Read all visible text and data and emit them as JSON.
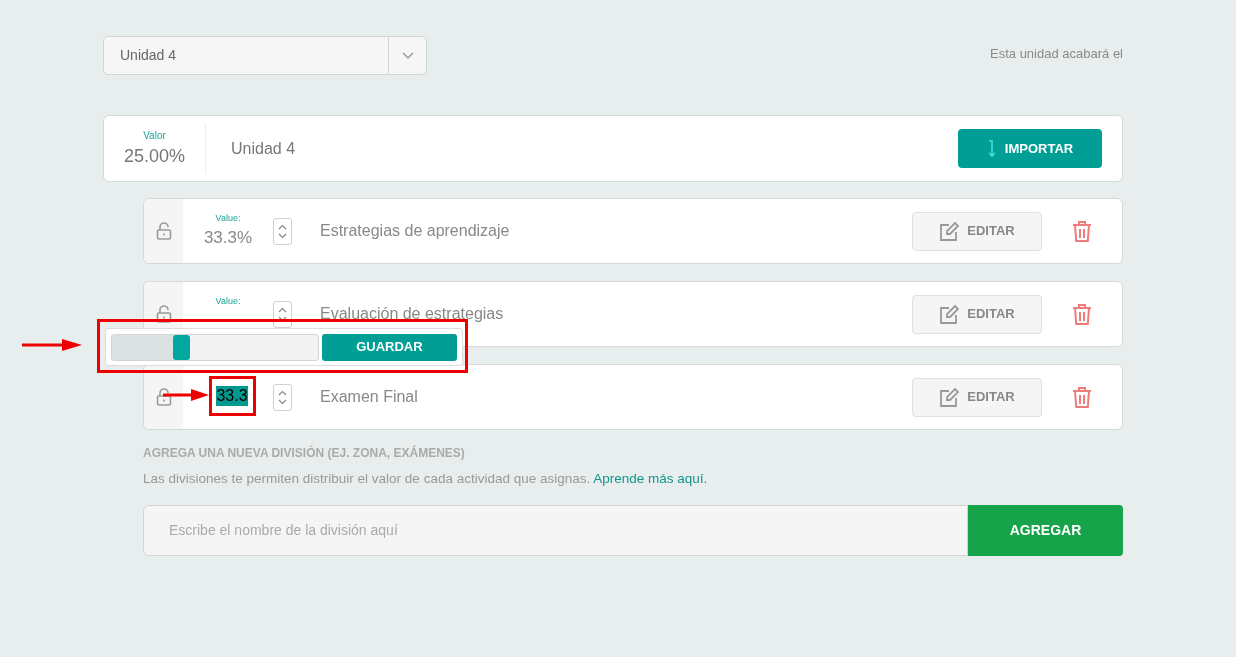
{
  "unit_select": {
    "value": "Unidad 4"
  },
  "end_note": "Esta unidad acabará el",
  "unit_card": {
    "value_label": "Valor",
    "value": "25.00%",
    "name": "Unidad 4",
    "import_button": "IMPORTAR"
  },
  "divisions": [
    {
      "value_label": "Value:",
      "value": "33.3%",
      "name": "Estrategias de aprendizaje",
      "edit_button": "EDITAR",
      "editing": false
    },
    {
      "value_label": "Value:",
      "name": "Evaluación de estrategias",
      "edit_button": "EDITAR",
      "editing": false
    },
    {
      "input_value": "33.3",
      "name": "Examen Final",
      "edit_button": "EDITAR",
      "editing": true
    }
  ],
  "popover": {
    "level": 0.34,
    "save_button": "GUARDAR"
  },
  "new_division": {
    "heading": "AGREGA UNA NUEVA DIVISIÓN (EJ. ZONA, EXÁMENES)",
    "help": "Las divisiones te permiten distribuir el valor de cada actividad que asignas.",
    "link": "Aprende más aquí.",
    "placeholder": "Escribe el nombre de la división aquí",
    "add_button": "AGREGAR"
  }
}
